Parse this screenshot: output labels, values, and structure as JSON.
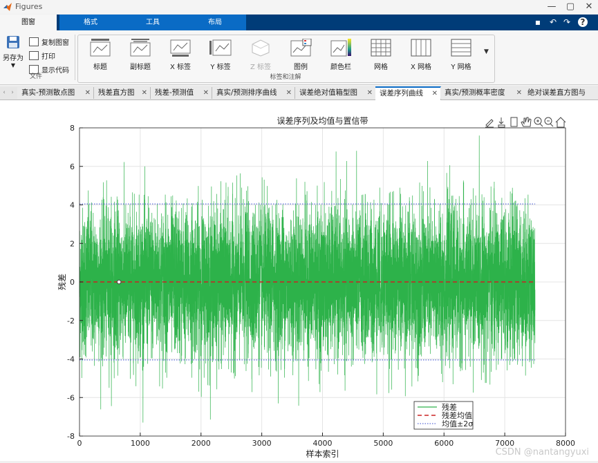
{
  "window": {
    "title": "Figures",
    "minimize": "—",
    "maximize": "▢",
    "close": "✕"
  },
  "ribbon_tabs": [
    "图窗",
    "格式",
    "工具",
    "布局"
  ],
  "file_group": {
    "save_as_label": "另存为",
    "copy_label": "复制图窗",
    "print_label": "打印",
    "show_code_label": "显示代码",
    "group_label": "文件"
  },
  "annotation_group": {
    "buttons": [
      "标题",
      "副标题",
      "X 标签",
      "Y 标签",
      "Z 标签",
      "图例",
      "颜色栏",
      "网格",
      "X 网格",
      "Y 网格"
    ],
    "disabled": [
      "Z 标签"
    ],
    "group_label": "标签和注解"
  },
  "doc_tabs": [
    "真实-预测散点图",
    "残差直方图",
    "残差-预测值",
    "真实/预测排序曲线",
    "误差绝对值箱型图",
    "误差序列曲线",
    "真实/预测概率密度",
    "绝对误差直方图与"
  ],
  "active_doc_tab": "误差序列曲线",
  "watermark": "CSDN @nantangyuxi",
  "colors": {
    "residual": "#2db24a",
    "mean": "#cc2222",
    "band": "#5a6bd8",
    "accent": "#0a6bc5"
  },
  "chart_data": {
    "type": "line",
    "title": "误差序列及均值与置信带",
    "xlabel": "样本索引",
    "ylabel": "残差",
    "xlim": [
      0,
      8000
    ],
    "ylim": [
      -8,
      8
    ],
    "xticks": [
      0,
      1000,
      2000,
      3000,
      4000,
      5000,
      6000,
      7000,
      8000
    ],
    "yticks": [
      -8,
      -6,
      -4,
      -2,
      0,
      2,
      4,
      6,
      8
    ],
    "grid": true,
    "legend_position": "bottom-right",
    "series": [
      {
        "name": "残差",
        "style": "solid",
        "color": "#2db24a",
        "n_points": 7500,
        "mean": 0,
        "std": 2.0,
        "approx_max": 7.6,
        "approx_min": -7.3
      },
      {
        "name": "残差均值",
        "style": "dashed",
        "color": "#cc2222",
        "x": [
          0,
          7500
        ],
        "y": [
          0,
          0
        ]
      },
      {
        "name": "均值±2σ",
        "style": "dotted",
        "color": "#5a6bd8",
        "x": [
          0,
          7500
        ],
        "y_upper": [
          4.05,
          4.05
        ],
        "y_lower": [
          -4.05,
          -4.05
        ]
      }
    ],
    "marker": {
      "x": 650,
      "y": 0
    }
  }
}
